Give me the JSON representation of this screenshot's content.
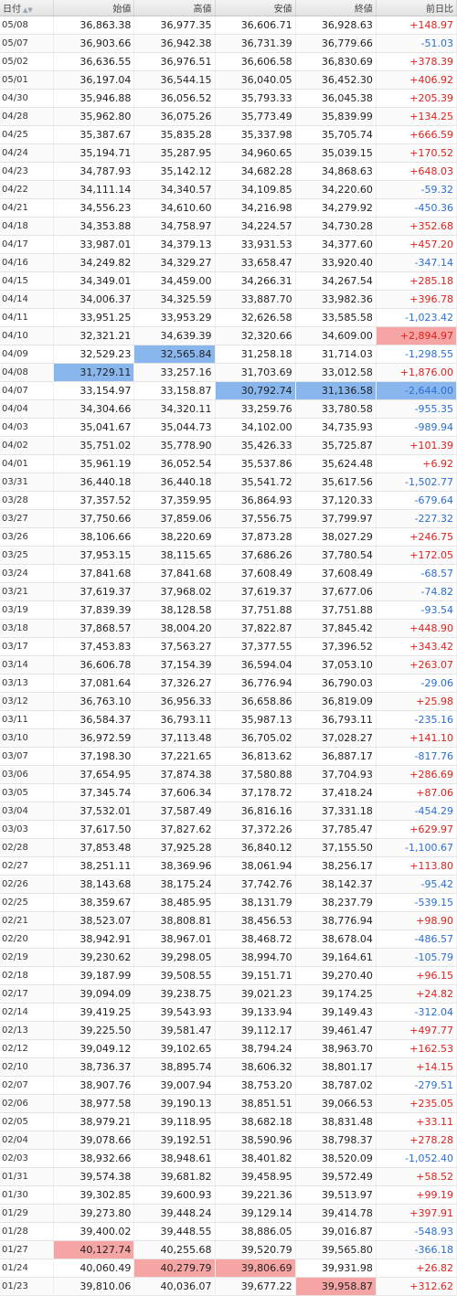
{
  "header": {
    "date": "日付",
    "open": "始値",
    "high": "高値",
    "low": "安値",
    "close": "終値",
    "change": "前日比",
    "sort_arrows": "▲▼"
  },
  "colors": {
    "positive": "#e0201a",
    "negative": "#2a6fd6",
    "highlight_red": "#f6a5a5",
    "highlight_blue": "#8ab6ee"
  },
  "rows": [
    {
      "date": "05/08",
      "open": "36,863.38",
      "high": "36,977.35",
      "low": "36,606.71",
      "close": "36,928.63",
      "change": "+148.97"
    },
    {
      "date": "05/07",
      "open": "36,903.66",
      "high": "36,942.38",
      "low": "36,731.39",
      "close": "36,779.66",
      "change": "-51.03"
    },
    {
      "date": "05/02",
      "open": "36,636.55",
      "high": "36,976.51",
      "low": "36,606.58",
      "close": "36,830.69",
      "change": "+378.39"
    },
    {
      "date": "05/01",
      "open": "36,197.04",
      "high": "36,544.15",
      "low": "36,040.05",
      "close": "36,452.30",
      "change": "+406.92"
    },
    {
      "date": "04/30",
      "open": "35,946.88",
      "high": "36,056.52",
      "low": "35,793.33",
      "close": "36,045.38",
      "change": "+205.39"
    },
    {
      "date": "04/28",
      "open": "35,962.80",
      "high": "36,075.26",
      "low": "35,773.49",
      "close": "35,839.99",
      "change": "+134.25"
    },
    {
      "date": "04/25",
      "open": "35,387.67",
      "high": "35,835.28",
      "low": "35,337.98",
      "close": "35,705.74",
      "change": "+666.59"
    },
    {
      "date": "04/24",
      "open": "35,194.71",
      "high": "35,287.95",
      "low": "34,960.65",
      "close": "35,039.15",
      "change": "+170.52"
    },
    {
      "date": "04/23",
      "open": "34,787.93",
      "high": "35,142.12",
      "low": "34,682.28",
      "close": "34,868.63",
      "change": "+648.03"
    },
    {
      "date": "04/22",
      "open": "34,111.14",
      "high": "34,340.57",
      "low": "34,109.85",
      "close": "34,220.60",
      "change": "-59.32"
    },
    {
      "date": "04/21",
      "open": "34,556.23",
      "high": "34,610.60",
      "low": "34,216.98",
      "close": "34,279.92",
      "change": "-450.36"
    },
    {
      "date": "04/18",
      "open": "34,353.88",
      "high": "34,758.97",
      "low": "34,224.57",
      "close": "34,730.28",
      "change": "+352.68"
    },
    {
      "date": "04/17",
      "open": "33,987.01",
      "high": "34,379.13",
      "low": "33,931.53",
      "close": "34,377.60",
      "change": "+457.20"
    },
    {
      "date": "04/16",
      "open": "34,249.82",
      "high": "34,329.27",
      "low": "33,658.47",
      "close": "33,920.40",
      "change": "-347.14"
    },
    {
      "date": "04/15",
      "open": "34,349.01",
      "high": "34,459.00",
      "low": "34,266.31",
      "close": "34,267.54",
      "change": "+285.18"
    },
    {
      "date": "04/14",
      "open": "34,006.37",
      "high": "34,325.59",
      "low": "33,887.70",
      "close": "33,982.36",
      "change": "+396.78"
    },
    {
      "date": "04/11",
      "open": "33,951.25",
      "high": "33,953.29",
      "low": "32,626.58",
      "close": "33,585.58",
      "change": "-1,023.42"
    },
    {
      "date": "04/10",
      "open": "32,321.21",
      "high": "34,639.39",
      "low": "32,320.66",
      "close": "34,609.00",
      "change": "+2,894.97",
      "hl": {
        "change": "red"
      }
    },
    {
      "date": "04/09",
      "open": "32,529.23",
      "high": "32,565.84",
      "low": "31,258.18",
      "close": "31,714.03",
      "change": "-1,298.55",
      "hl": {
        "high": "blue"
      }
    },
    {
      "date": "04/08",
      "open": "31,729.11",
      "high": "33,257.16",
      "low": "31,703.69",
      "close": "33,012.58",
      "change": "+1,876.00",
      "hl": {
        "open": "blue"
      }
    },
    {
      "date": "04/07",
      "open": "33,154.97",
      "high": "33,158.87",
      "low": "30,792.74",
      "close": "31,136.58",
      "change": "-2,644.00",
      "hl": {
        "low": "blue",
        "close": "blue",
        "change": "blue"
      }
    },
    {
      "date": "04/04",
      "open": "34,304.66",
      "high": "34,320.11",
      "low": "33,259.76",
      "close": "33,780.58",
      "change": "-955.35"
    },
    {
      "date": "04/03",
      "open": "35,041.67",
      "high": "35,044.73",
      "low": "34,102.00",
      "close": "34,735.93",
      "change": "-989.94"
    },
    {
      "date": "04/02",
      "open": "35,751.02",
      "high": "35,778.90",
      "low": "35,426.33",
      "close": "35,725.87",
      "change": "+101.39"
    },
    {
      "date": "04/01",
      "open": "35,961.19",
      "high": "36,052.54",
      "low": "35,537.86",
      "close": "35,624.48",
      "change": "+6.92"
    },
    {
      "date": "03/31",
      "open": "36,440.18",
      "high": "36,440.18",
      "low": "35,541.72",
      "close": "35,617.56",
      "change": "-1,502.77"
    },
    {
      "date": "03/28",
      "open": "37,357.52",
      "high": "37,359.95",
      "low": "36,864.93",
      "close": "37,120.33",
      "change": "-679.64"
    },
    {
      "date": "03/27",
      "open": "37,750.66",
      "high": "37,859.06",
      "low": "37,556.75",
      "close": "37,799.97",
      "change": "-227.32"
    },
    {
      "date": "03/26",
      "open": "38,106.66",
      "high": "38,220.69",
      "low": "37,873.28",
      "close": "38,027.29",
      "change": "+246.75"
    },
    {
      "date": "03/25",
      "open": "37,953.15",
      "high": "38,115.65",
      "low": "37,686.26",
      "close": "37,780.54",
      "change": "+172.05"
    },
    {
      "date": "03/24",
      "open": "37,841.68",
      "high": "37,841.68",
      "low": "37,608.49",
      "close": "37,608.49",
      "change": "-68.57"
    },
    {
      "date": "03/21",
      "open": "37,619.37",
      "high": "37,968.02",
      "low": "37,619.37",
      "close": "37,677.06",
      "change": "-74.82"
    },
    {
      "date": "03/19",
      "open": "37,839.39",
      "high": "38,128.58",
      "low": "37,751.88",
      "close": "37,751.88",
      "change": "-93.54"
    },
    {
      "date": "03/18",
      "open": "37,868.57",
      "high": "38,004.20",
      "low": "37,822.87",
      "close": "37,845.42",
      "change": "+448.90"
    },
    {
      "date": "03/17",
      "open": "37,453.83",
      "high": "37,563.27",
      "low": "37,377.55",
      "close": "37,396.52",
      "change": "+343.42"
    },
    {
      "date": "03/14",
      "open": "36,606.78",
      "high": "37,154.39",
      "low": "36,594.04",
      "close": "37,053.10",
      "change": "+263.07"
    },
    {
      "date": "03/13",
      "open": "37,081.64",
      "high": "37,326.27",
      "low": "36,776.94",
      "close": "36,790.03",
      "change": "-29.06"
    },
    {
      "date": "03/12",
      "open": "36,763.10",
      "high": "36,956.33",
      "low": "36,658.86",
      "close": "36,819.09",
      "change": "+25.98"
    },
    {
      "date": "03/11",
      "open": "36,584.37",
      "high": "36,793.11",
      "low": "35,987.13",
      "close": "36,793.11",
      "change": "-235.16"
    },
    {
      "date": "03/10",
      "open": "36,972.59",
      "high": "37,113.48",
      "low": "36,705.02",
      "close": "37,028.27",
      "change": "+141.10"
    },
    {
      "date": "03/07",
      "open": "37,198.30",
      "high": "37,221.65",
      "low": "36,813.62",
      "close": "36,887.17",
      "change": "-817.76"
    },
    {
      "date": "03/06",
      "open": "37,654.95",
      "high": "37,874.38",
      "low": "37,580.88",
      "close": "37,704.93",
      "change": "+286.69"
    },
    {
      "date": "03/05",
      "open": "37,345.74",
      "high": "37,606.34",
      "low": "37,178.72",
      "close": "37,418.24",
      "change": "+87.06"
    },
    {
      "date": "03/04",
      "open": "37,532.01",
      "high": "37,587.49",
      "low": "36,816.16",
      "close": "37,331.18",
      "change": "-454.29"
    },
    {
      "date": "03/03",
      "open": "37,617.50",
      "high": "37,827.62",
      "low": "37,372.26",
      "close": "37,785.47",
      "change": "+629.97"
    },
    {
      "date": "02/28",
      "open": "37,853.48",
      "high": "37,925.28",
      "low": "36,840.12",
      "close": "37,155.50",
      "change": "-1,100.67"
    },
    {
      "date": "02/27",
      "open": "38,251.11",
      "high": "38,369.96",
      "low": "38,061.94",
      "close": "38,256.17",
      "change": "+113.80"
    },
    {
      "date": "02/26",
      "open": "38,143.68",
      "high": "38,175.24",
      "low": "37,742.76",
      "close": "38,142.37",
      "change": "-95.42"
    },
    {
      "date": "02/25",
      "open": "38,359.67",
      "high": "38,485.95",
      "low": "38,131.79",
      "close": "38,237.79",
      "change": "-539.15"
    },
    {
      "date": "02/21",
      "open": "38,523.07",
      "high": "38,808.81",
      "low": "38,456.53",
      "close": "38,776.94",
      "change": "+98.90"
    },
    {
      "date": "02/20",
      "open": "38,942.91",
      "high": "38,967.01",
      "low": "38,468.72",
      "close": "38,678.04",
      "change": "-486.57"
    },
    {
      "date": "02/19",
      "open": "39,230.62",
      "high": "39,298.05",
      "low": "38,994.70",
      "close": "39,164.61",
      "change": "-105.79"
    },
    {
      "date": "02/18",
      "open": "39,187.99",
      "high": "39,508.55",
      "low": "39,151.71",
      "close": "39,270.40",
      "change": "+96.15"
    },
    {
      "date": "02/17",
      "open": "39,094.09",
      "high": "39,238.75",
      "low": "39,021.23",
      "close": "39,174.25",
      "change": "+24.82"
    },
    {
      "date": "02/14",
      "open": "39,419.25",
      "high": "39,543.93",
      "low": "39,133.94",
      "close": "39,149.43",
      "change": "-312.04"
    },
    {
      "date": "02/13",
      "open": "39,225.50",
      "high": "39,581.47",
      "low": "39,112.17",
      "close": "39,461.47",
      "change": "+497.77"
    },
    {
      "date": "02/12",
      "open": "39,049.12",
      "high": "39,102.65",
      "low": "38,794.24",
      "close": "38,963.70",
      "change": "+162.53"
    },
    {
      "date": "02/10",
      "open": "38,736.37",
      "high": "38,895.74",
      "low": "38,606.32",
      "close": "38,801.17",
      "change": "+14.15"
    },
    {
      "date": "02/07",
      "open": "38,907.76",
      "high": "39,007.94",
      "low": "38,753.20",
      "close": "38,787.02",
      "change": "-279.51"
    },
    {
      "date": "02/06",
      "open": "38,977.58",
      "high": "39,190.13",
      "low": "38,851.51",
      "close": "39,066.53",
      "change": "+235.05"
    },
    {
      "date": "02/05",
      "open": "38,979.21",
      "high": "39,118.95",
      "low": "38,682.18",
      "close": "38,831.48",
      "change": "+33.11"
    },
    {
      "date": "02/04",
      "open": "39,078.66",
      "high": "39,192.51",
      "low": "38,590.96",
      "close": "38,798.37",
      "change": "+278.28"
    },
    {
      "date": "02/03",
      "open": "38,932.66",
      "high": "38,948.61",
      "low": "38,401.82",
      "close": "38,520.09",
      "change": "-1,052.40"
    },
    {
      "date": "01/31",
      "open": "39,574.38",
      "high": "39,681.82",
      "low": "39,458.95",
      "close": "39,572.49",
      "change": "+58.52"
    },
    {
      "date": "01/30",
      "open": "39,302.85",
      "high": "39,600.93",
      "low": "39,221.36",
      "close": "39,513.97",
      "change": "+99.19"
    },
    {
      "date": "01/29",
      "open": "39,273.80",
      "high": "39,448.24",
      "low": "39,129.14",
      "close": "39,414.78",
      "change": "+397.91"
    },
    {
      "date": "01/28",
      "open": "39,400.02",
      "high": "39,448.55",
      "low": "38,886.05",
      "close": "39,016.87",
      "change": "-548.93"
    },
    {
      "date": "01/27",
      "open": "40,127.74",
      "high": "40,255.68",
      "low": "39,520.79",
      "close": "39,565.80",
      "change": "-366.18",
      "hl": {
        "open": "red"
      }
    },
    {
      "date": "01/24",
      "open": "40,060.49",
      "high": "40,279.79",
      "low": "39,806.69",
      "close": "39,931.98",
      "change": "+26.82",
      "hl": {
        "high": "red",
        "low": "red"
      }
    },
    {
      "date": "01/23",
      "open": "39,810.06",
      "high": "40,036.07",
      "low": "39,677.22",
      "close": "39,958.87",
      "change": "+312.62",
      "hl": {
        "close": "red"
      }
    }
  ]
}
